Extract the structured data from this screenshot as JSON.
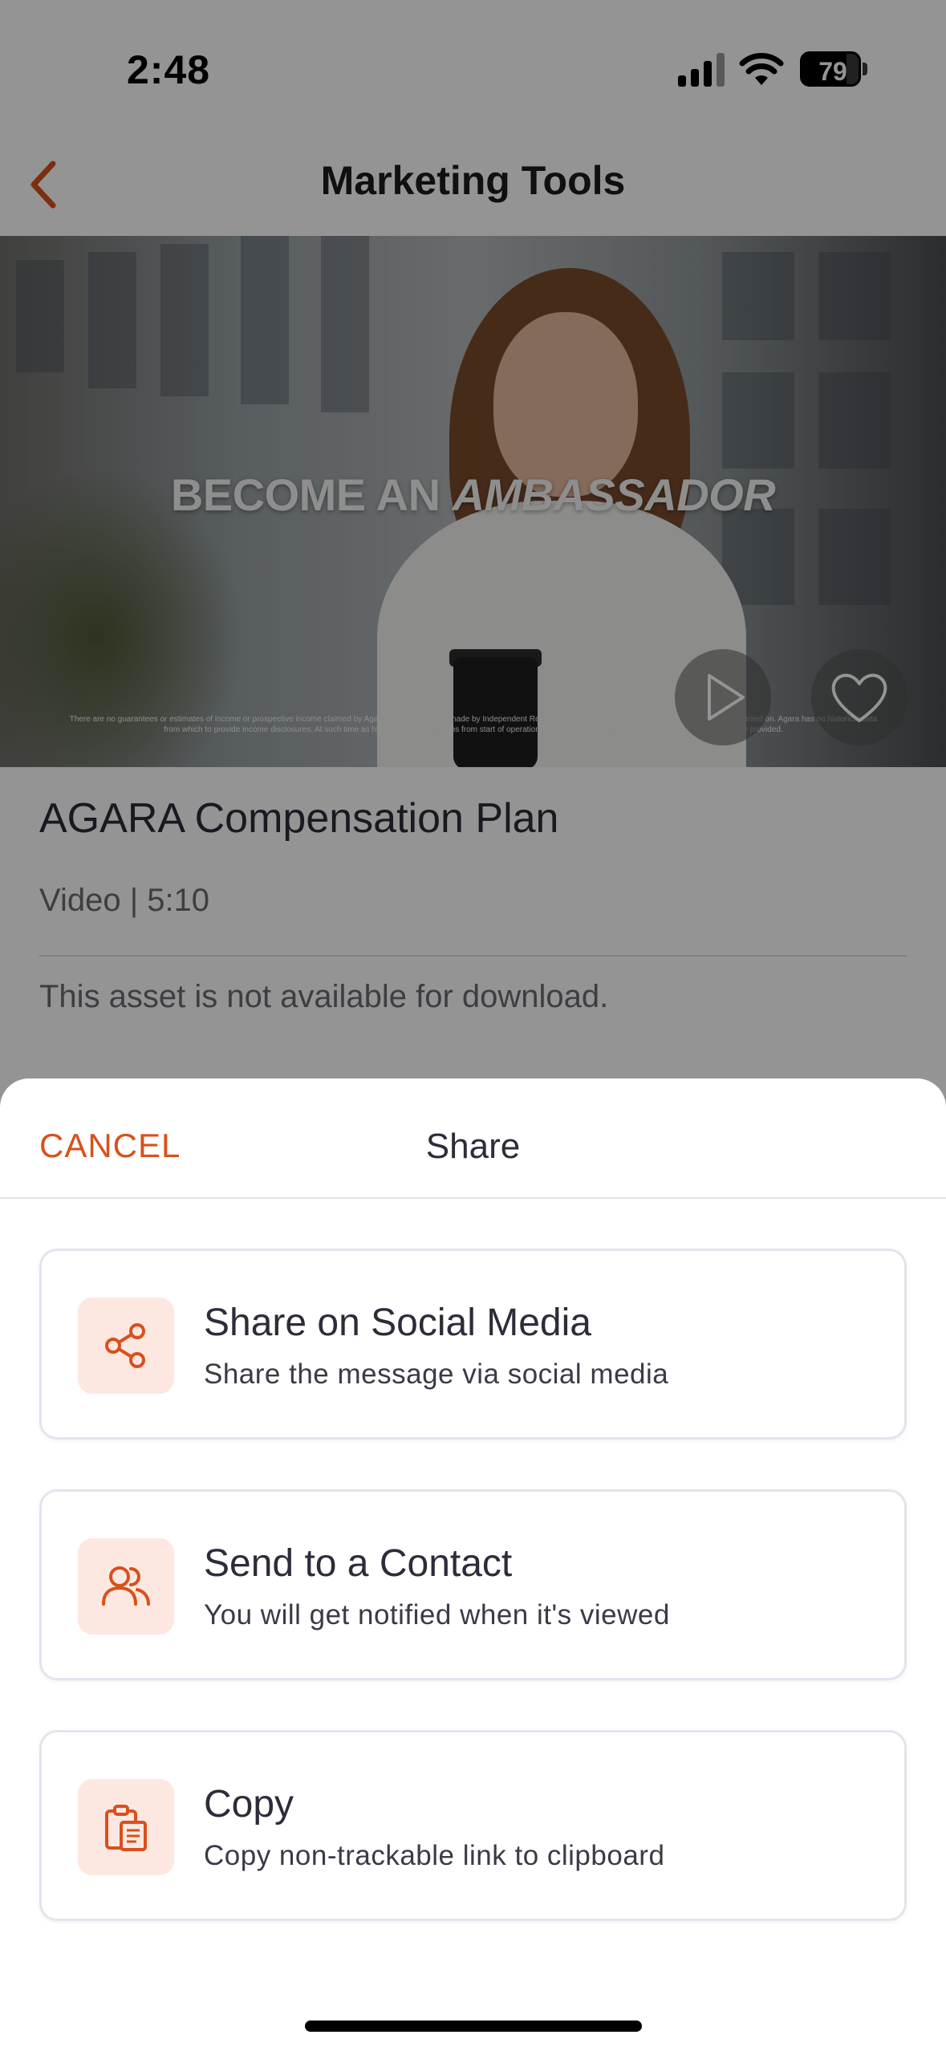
{
  "status_bar": {
    "time": "2:48",
    "battery_percent": 79,
    "battery_label": "79"
  },
  "nav": {
    "title": "Marketing Tools"
  },
  "hero": {
    "headline_part1": "BECOME AN ",
    "headline_part2": "AMBASSADOR",
    "disclaimer": "There are no guarantees or estimates of income or prospective income claimed by Agara. Any such claims made by Independent Representative should be ignored. Agara and should not be relied on. Agara has no historical data from which to provide income disclosures. At such time as historical data (6 months from start of operations) is available, a detailed Income Disclosure Chart shall be provided."
  },
  "asset": {
    "title": "AGARA Compensation Plan",
    "meta": "Video | 5:10",
    "note": "This asset is not available for download."
  },
  "sheet": {
    "cancel_label": "CANCEL",
    "title": "Share",
    "options": [
      {
        "icon": "share-icon",
        "title": "Share on Social Media",
        "subtitle": "Share the message via social media"
      },
      {
        "icon": "contacts-icon",
        "title": "Send to a Contact",
        "subtitle": "You will get notified when it's viewed"
      },
      {
        "icon": "clipboard-icon",
        "title": "Copy",
        "subtitle": "Copy non-trackable link to clipboard"
      }
    ]
  },
  "colors": {
    "accent": "#D9501C",
    "icon_bg": "#FDE8E1",
    "text_primary": "#2C2C3A"
  }
}
